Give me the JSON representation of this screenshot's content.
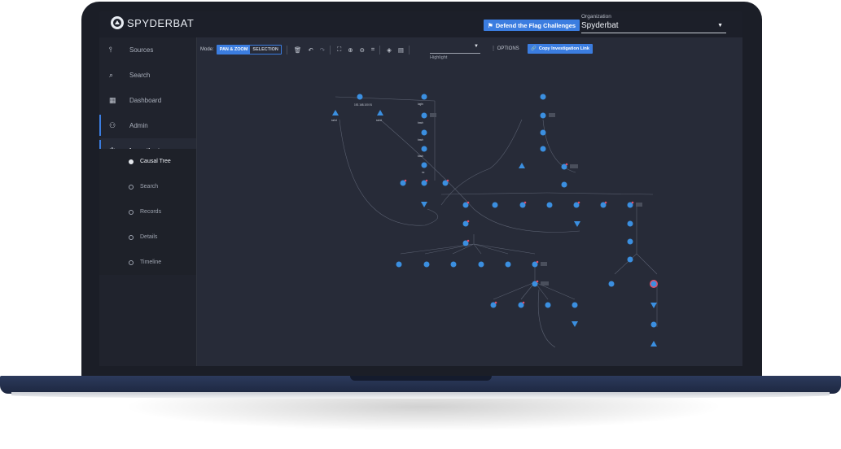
{
  "app": {
    "name": "SPYDERBAT"
  },
  "header": {
    "flag_button": "Defend the Flag Challenges",
    "org_label": "Organization",
    "org_value": "Spyderbat"
  },
  "sidebar": {
    "items": [
      {
        "label": "Sources",
        "icon": "wifi-tower-icon"
      },
      {
        "label": "Search",
        "icon": "search-icon"
      },
      {
        "label": "Dashboard",
        "icon": "dashboard-icon"
      },
      {
        "label": "Admin",
        "icon": "people-icon"
      },
      {
        "label": "Investigate",
        "icon": "spider-icon"
      }
    ],
    "sub_items": [
      {
        "label": "Causal Tree"
      },
      {
        "label": "Search"
      },
      {
        "label": "Records"
      },
      {
        "label": "Details"
      },
      {
        "label": "Timeline"
      }
    ]
  },
  "toolbar": {
    "mode_label": "Mode:",
    "mode_pan": "PAN & ZOOM",
    "mode_selection": "SELECTION",
    "highlight_label": "Highlight",
    "options": "OPTIONS",
    "copy_link": "Copy Investigation Link"
  },
  "colors": {
    "accent": "#3b7de0",
    "alert": "#e0506a",
    "node": "#3b8fe0"
  }
}
